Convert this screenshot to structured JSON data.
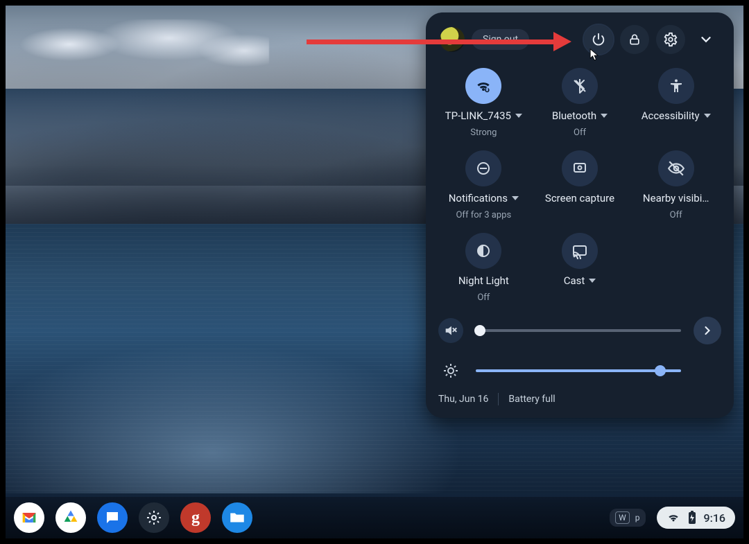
{
  "header": {
    "sign_out_label": "Sign out"
  },
  "tiles": {
    "wifi": {
      "label": "TP-LINK_7435",
      "sub": "Strong",
      "has_dropdown": true,
      "on": true
    },
    "bluetooth": {
      "label": "Bluetooth",
      "sub": "Off",
      "has_dropdown": true,
      "on": false
    },
    "accessibility": {
      "label": "Accessibility",
      "sub": "",
      "has_dropdown": true,
      "on": false
    },
    "notifications": {
      "label": "Notifications",
      "sub": "Off for 3 apps",
      "has_dropdown": true,
      "on": false
    },
    "screencapture": {
      "label": "Screen capture",
      "sub": "",
      "has_dropdown": false,
      "on": false
    },
    "nearby": {
      "label": "Nearby visibi…",
      "sub": "Off",
      "has_dropdown": false,
      "on": false
    },
    "nightlight": {
      "label": "Night Light",
      "sub": "Off",
      "has_dropdown": false,
      "on": false
    },
    "cast": {
      "label": "Cast",
      "sub": "",
      "has_dropdown": true,
      "on": false
    }
  },
  "sliders": {
    "volume_percent": 2,
    "brightness_percent": 90
  },
  "footer": {
    "date": "Thu, Jun 16",
    "battery": "Battery full"
  },
  "tray": {
    "badge1": "W",
    "badge2": "p"
  },
  "status": {
    "time": "9:16"
  },
  "colors": {
    "accent": "#8ab4f8",
    "panel": "#16202e"
  }
}
